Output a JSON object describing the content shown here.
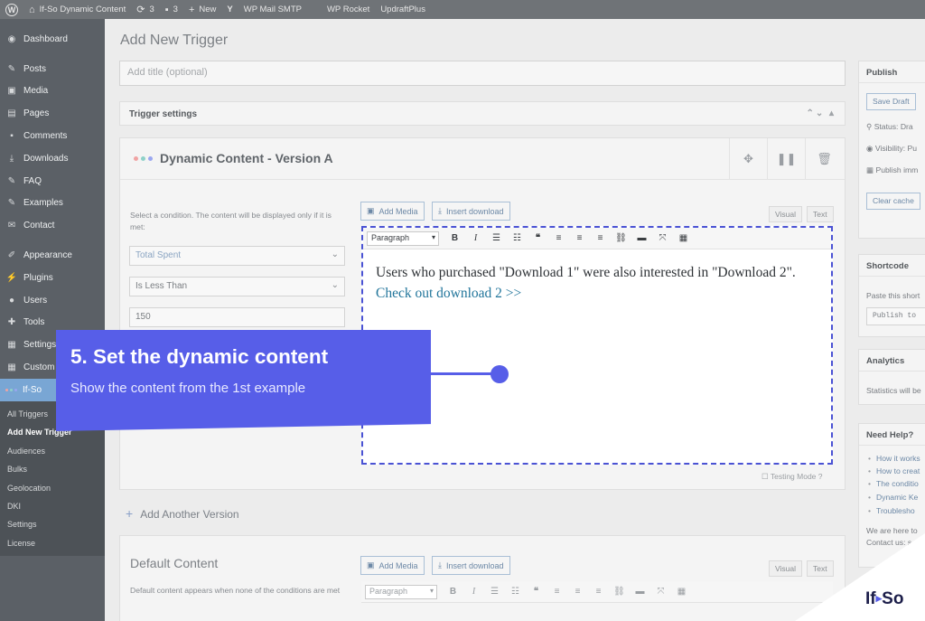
{
  "admin_bar": {
    "wp_logo": "W",
    "site_name": "If-So Dynamic Content",
    "updates_count": "3",
    "comments_count": "3",
    "new_label": "New",
    "items": [
      "WP Mail SMTP",
      "WP Rocket",
      "UpdraftPlus"
    ]
  },
  "sidebar": {
    "items_top": [
      {
        "label": "Dashboard",
        "icon": "dashboard-icon",
        "glyph": "◉"
      }
    ],
    "items_content": [
      {
        "label": "Posts",
        "icon": "pin-icon",
        "glyph": "✎"
      },
      {
        "label": "Media",
        "icon": "media-icon",
        "glyph": "▣"
      },
      {
        "label": "Pages",
        "icon": "pages-icon",
        "glyph": "▤"
      },
      {
        "label": "Comments",
        "icon": "comment-icon",
        "glyph": "▪"
      },
      {
        "label": "Downloads",
        "icon": "download-icon",
        "glyph": "⤓"
      },
      {
        "label": "FAQ",
        "icon": "pin-icon",
        "glyph": "✎"
      },
      {
        "label": "Examples",
        "icon": "pin-icon",
        "glyph": "✎"
      },
      {
        "label": "Contact",
        "icon": "mail-icon",
        "glyph": "✉"
      }
    ],
    "items_admin": [
      {
        "label": "Appearance",
        "icon": "brush-icon",
        "glyph": "✐"
      },
      {
        "label": "Plugins",
        "icon": "plug-icon",
        "glyph": "⚡"
      },
      {
        "label": "Users",
        "icon": "user-icon",
        "glyph": "●"
      },
      {
        "label": "Tools",
        "icon": "wrench-icon",
        "glyph": "✚"
      },
      {
        "label": "Settings",
        "icon": "settings-icon",
        "glyph": "▦"
      },
      {
        "label": "Custom",
        "icon": "table-icon",
        "glyph": "▦"
      }
    ],
    "active_item": {
      "label": "If-So"
    },
    "submenu": [
      "All Triggers",
      "Add New Trigger",
      "Audiences",
      "Bulks",
      "Geolocation",
      "DKI",
      "Settings",
      "License"
    ]
  },
  "main": {
    "page_title": "Add New Trigger",
    "title_placeholder": "Add title (optional)",
    "trigger_settings_label": "Trigger settings",
    "version": {
      "title": "Dynamic Content - Version A",
      "condition_help": "Select a condition. The content will be displayed only if it is met:",
      "condition_type": "Total Spent",
      "operator": "Is Less Than",
      "value": "150",
      "add_media_label": "Add Media",
      "insert_download_label": "Insert download",
      "tab_visual": "Visual",
      "tab_text": "Text",
      "format_select": "Paragraph",
      "content_text": "Users who purchased \"Download 1\" were also interested in \"Download 2\". ",
      "content_link": "Check out download 2 >>",
      "testing_mode_label": "Testing Mode"
    },
    "add_version_label": "Add Another Version",
    "default": {
      "title": "Default Content",
      "description": "Default content appears when none of the conditions are met",
      "add_media_label": "Add Media",
      "insert_download_label": "Insert download",
      "tab_visual": "Visual",
      "tab_text": "Text",
      "format_select": "Paragraph"
    }
  },
  "right": {
    "publish": {
      "heading": "Publish",
      "save_draft": "Save Draft",
      "status": "Status: Dra",
      "visibility": "Visibility: Pu",
      "publish_time": "Publish imm",
      "clear_cache": "Clear cache"
    },
    "shortcode": {
      "heading": "Shortcode",
      "paste_text": "Paste this short",
      "code": "Publish to"
    },
    "analytics": {
      "heading": "Analytics",
      "text": "Statistics will be"
    },
    "help": {
      "heading": "Need Help?",
      "links": [
        "How it works",
        "How to creat",
        "The conditio",
        "Dynamic Ke",
        "Troublesho"
      ],
      "footer1": "We are here to",
      "footer2": "Contact us: s"
    }
  },
  "callout": {
    "title": "5. Set the dynamic content",
    "subtitle": "Show the content from the 1st example"
  },
  "brand": {
    "left": "If",
    "right": "So"
  },
  "colors": {
    "accent": "#575ee8",
    "link": "#21759b",
    "sidebar": "#5b6066",
    "admin_bar": "#6f7377"
  }
}
